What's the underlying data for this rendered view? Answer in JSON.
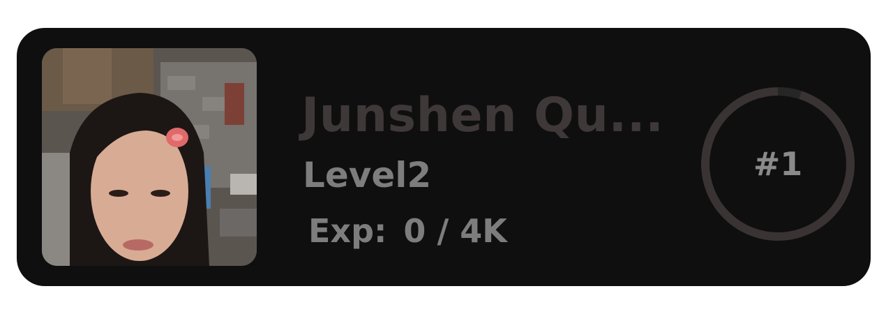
{
  "profile": {
    "name": "Junshen Qu...",
    "level_text": "Level2",
    "exp_label": "Exp:",
    "exp_value": "0 / 4K",
    "rank": "#1",
    "rank_progress": 0.05
  },
  "colors": {
    "card_bg": "#0f0f0f",
    "name": "#3f3838",
    "muted_text": "#7d7d7d",
    "ring_track": "#262626",
    "ring_fill": "#3a3333"
  }
}
